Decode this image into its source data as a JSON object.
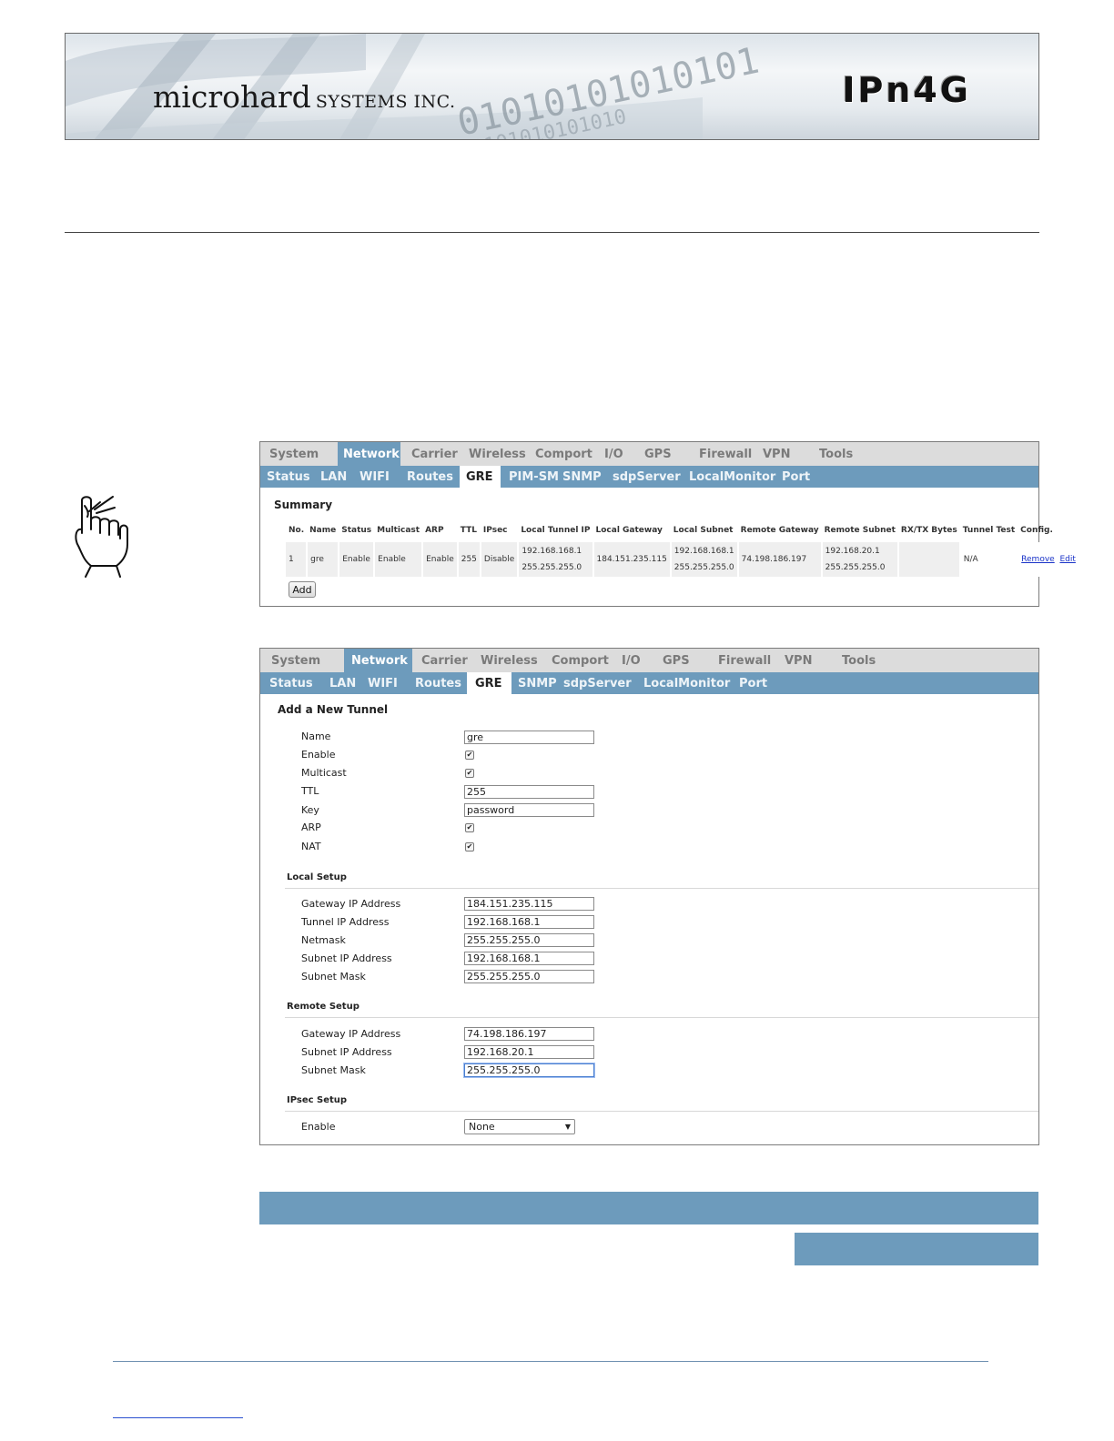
{
  "header": {
    "brand_main": "microhard",
    "brand_sub": "SYSTEMS INC.",
    "product": "IPn4G",
    "binary_line1": "01010101010101",
    "binary_line2": "0101010101010"
  },
  "summary_panel": {
    "nav_main": [
      "System",
      "Network",
      "Carrier",
      "Wireless",
      "Comport",
      "I/O",
      "GPS",
      "Firewall",
      "VPN",
      "Tools"
    ],
    "nav_main_active": "Network",
    "nav_sub": [
      "Status",
      "LAN",
      "WIFI",
      "Routes",
      "GRE",
      "PIM-SM",
      "SNMP",
      "sdpServer",
      "LocalMonitor",
      "Port"
    ],
    "nav_sub_active": "GRE",
    "title": "Summary",
    "columns": [
      "No.",
      "Name",
      "Status",
      "Multicast",
      "ARP",
      "TTL",
      "IPsec",
      "Local Tunnel IP",
      "Local Gateway",
      "Local Subnet",
      "Remote Gateway",
      "Remote Subnet",
      "RX/TX Bytes",
      "Tunnel Test",
      "Config."
    ],
    "row": {
      "no": "1",
      "name": "gre",
      "status": "Enable",
      "multicast": "Enable",
      "arp": "Enable",
      "ttl": "255",
      "ipsec": "Disable",
      "local_tunnel_ip": "192.168.168.1",
      "local_tunnel_mask": "255.255.255.0",
      "local_gateway": "184.151.235.115",
      "local_subnet": "192.168.168.1",
      "local_subnet_mask": "255.255.255.0",
      "remote_gateway": "74.198.186.197",
      "remote_subnet": "192.168.20.1",
      "remote_subnet_mask": "255.255.255.0",
      "rxtx": "",
      "tunnel_test": "N/A",
      "remove": "Remove",
      "edit": "Edit"
    },
    "add_button": "Add"
  },
  "form_panel": {
    "nav_main": [
      "System",
      "Network",
      "Carrier",
      "Wireless",
      "Comport",
      "I/O",
      "GPS",
      "Firewall",
      "VPN",
      "Tools"
    ],
    "nav_main_active": "Network",
    "nav_sub": [
      "Status",
      "LAN",
      "WIFI",
      "Routes",
      "GRE",
      "SNMP",
      "sdpServer",
      "LocalMonitor",
      "Port"
    ],
    "nav_sub_active": "GRE",
    "title": "Add a New Tunnel",
    "general": {
      "name_label": "Name",
      "name_value": "gre",
      "enable_label": "Enable",
      "enable_checked": true,
      "multicast_label": "Multicast",
      "multicast_checked": true,
      "ttl_label": "TTL",
      "ttl_value": "255",
      "key_label": "Key",
      "key_value": "password",
      "arp_label": "ARP",
      "arp_checked": true,
      "nat_label": "NAT",
      "nat_checked": true
    },
    "local_setup": {
      "title": "Local Setup",
      "gateway_label": "Gateway IP Address",
      "gateway_value": "184.151.235.115",
      "tunnel_label": "Tunnel IP Address",
      "tunnel_value": "192.168.168.1",
      "netmask_label": "Netmask",
      "netmask_value": "255.255.255.0",
      "subnet_ip_label": "Subnet IP Address",
      "subnet_ip_value": "192.168.168.1",
      "subnet_mask_label": "Subnet Mask",
      "subnet_mask_value": "255.255.255.0"
    },
    "remote_setup": {
      "title": "Remote Setup",
      "gateway_label": "Gateway IP Address",
      "gateway_value": "74.198.186.197",
      "subnet_ip_label": "Subnet IP Address",
      "subnet_ip_value": "192.168.20.1",
      "subnet_mask_label": "Subnet Mask",
      "subnet_mask_value": "255.255.255.0"
    },
    "ipsec_setup": {
      "title": "IPsec Setup",
      "enable_label": "Enable",
      "enable_value": "None"
    }
  },
  "colors": {
    "accent_blue": "#6d9bbc",
    "nav_grey": "#dcdcdc",
    "link_blue": "#1a33c8"
  },
  "icons": {
    "note": "pointing-hand-icon",
    "check": "checkmark-icon",
    "dropdown": "triangle-down-icon"
  }
}
